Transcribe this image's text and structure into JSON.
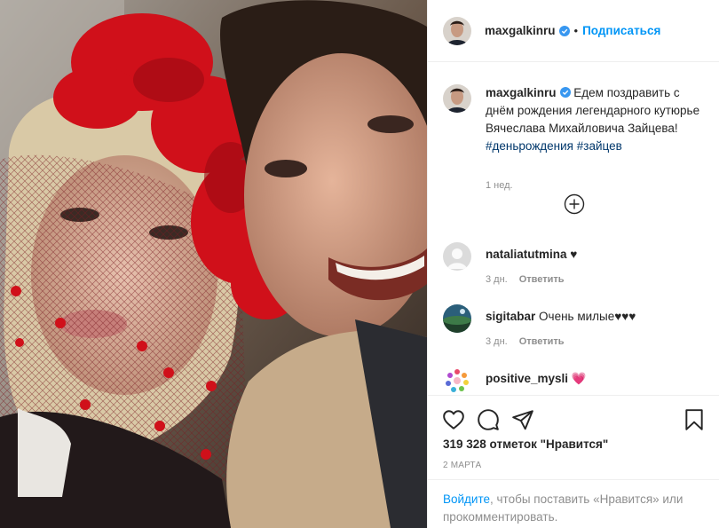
{
  "header": {
    "username": "maxgalkinru",
    "separator": "•",
    "follow_label": "Подписаться"
  },
  "caption": {
    "username": "maxgalkinru",
    "text": "Едем поздравить с днём рождения легендарного кутюрье Вячеслава Михайловича Зайцева!",
    "hashtags": [
      "#деньрождения",
      "#зайцев"
    ],
    "time": "1 нед."
  },
  "comments": [
    {
      "username": "nataliatutmina",
      "text": "♥",
      "time": "3 дн.",
      "reply_label": "Ответить"
    },
    {
      "username": "sigitabar",
      "text": "Очень милые♥♥♥",
      "time": "3 дн.",
      "reply_label": "Ответить"
    },
    {
      "username": "positive_mysli",
      "text": "💗",
      "time": "",
      "reply_label": ""
    }
  ],
  "actions": {
    "like_icon": "heart-icon",
    "comment_icon": "comment-icon",
    "share_icon": "share-icon",
    "save_icon": "bookmark-icon"
  },
  "likes_text": "319 328 отметок \"Нравится\"",
  "date": "2 МАРТА",
  "login": {
    "link": "Войдите",
    "rest": ", чтобы поставить «Нравится» или прокомментировать."
  },
  "colors": {
    "accent": "#0095f6",
    "text": "#262626",
    "muted": "#8e8e8e",
    "hashtag": "#00376b",
    "border": "#efefef"
  }
}
